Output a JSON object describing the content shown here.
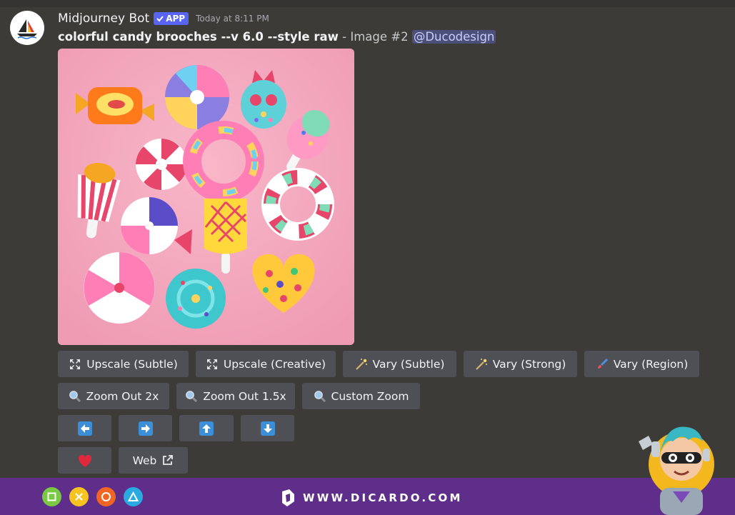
{
  "message": {
    "bot_name": "Midjourney Bot",
    "app_badge": "APP",
    "timestamp": "Today at 8:11 PM",
    "prompt_bold": "colorful candy brooches --v 6.0 --style raw",
    "prompt_suffix": " - Image #2 ",
    "mention": "@Ducodesign"
  },
  "buttons": {
    "row1": [
      {
        "label": "Upscale (Subtle)",
        "icon": "expand-icon"
      },
      {
        "label": "Upscale (Creative)",
        "icon": "expand-icon"
      },
      {
        "label": "Vary (Subtle)",
        "icon": "magic-wand-icon"
      },
      {
        "label": "Vary (Strong)",
        "icon": "magic-wand-icon"
      },
      {
        "label": "Vary (Region)",
        "icon": "paintbrush-icon"
      }
    ],
    "row2": [
      {
        "label": "Zoom Out 2x",
        "icon": "magnifier-icon"
      },
      {
        "label": "Zoom Out 1.5x",
        "icon": "magnifier-icon"
      },
      {
        "label": "Custom Zoom",
        "icon": "magnifier-icon"
      }
    ],
    "row3": [
      {
        "icon": "arrow-left-icon"
      },
      {
        "icon": "arrow-right-icon"
      },
      {
        "icon": "arrow-up-icon"
      },
      {
        "icon": "arrow-down-icon"
      }
    ],
    "row4": [
      {
        "icon": "heart-icon"
      },
      {
        "label": "Web",
        "icon": "external-link-icon"
      }
    ]
  },
  "footer": {
    "brand_text": "WWW.DICARDO.COM",
    "controller_icons": [
      "square-icon",
      "cross-icon",
      "circle-icon",
      "triangle-icon"
    ]
  },
  "colors": {
    "background": "#3c3b38",
    "button": "#4f5055",
    "app_badge": "#5865f2",
    "footer": "#5f2e8a",
    "arrow_button_icon": "#3b8fd9"
  }
}
